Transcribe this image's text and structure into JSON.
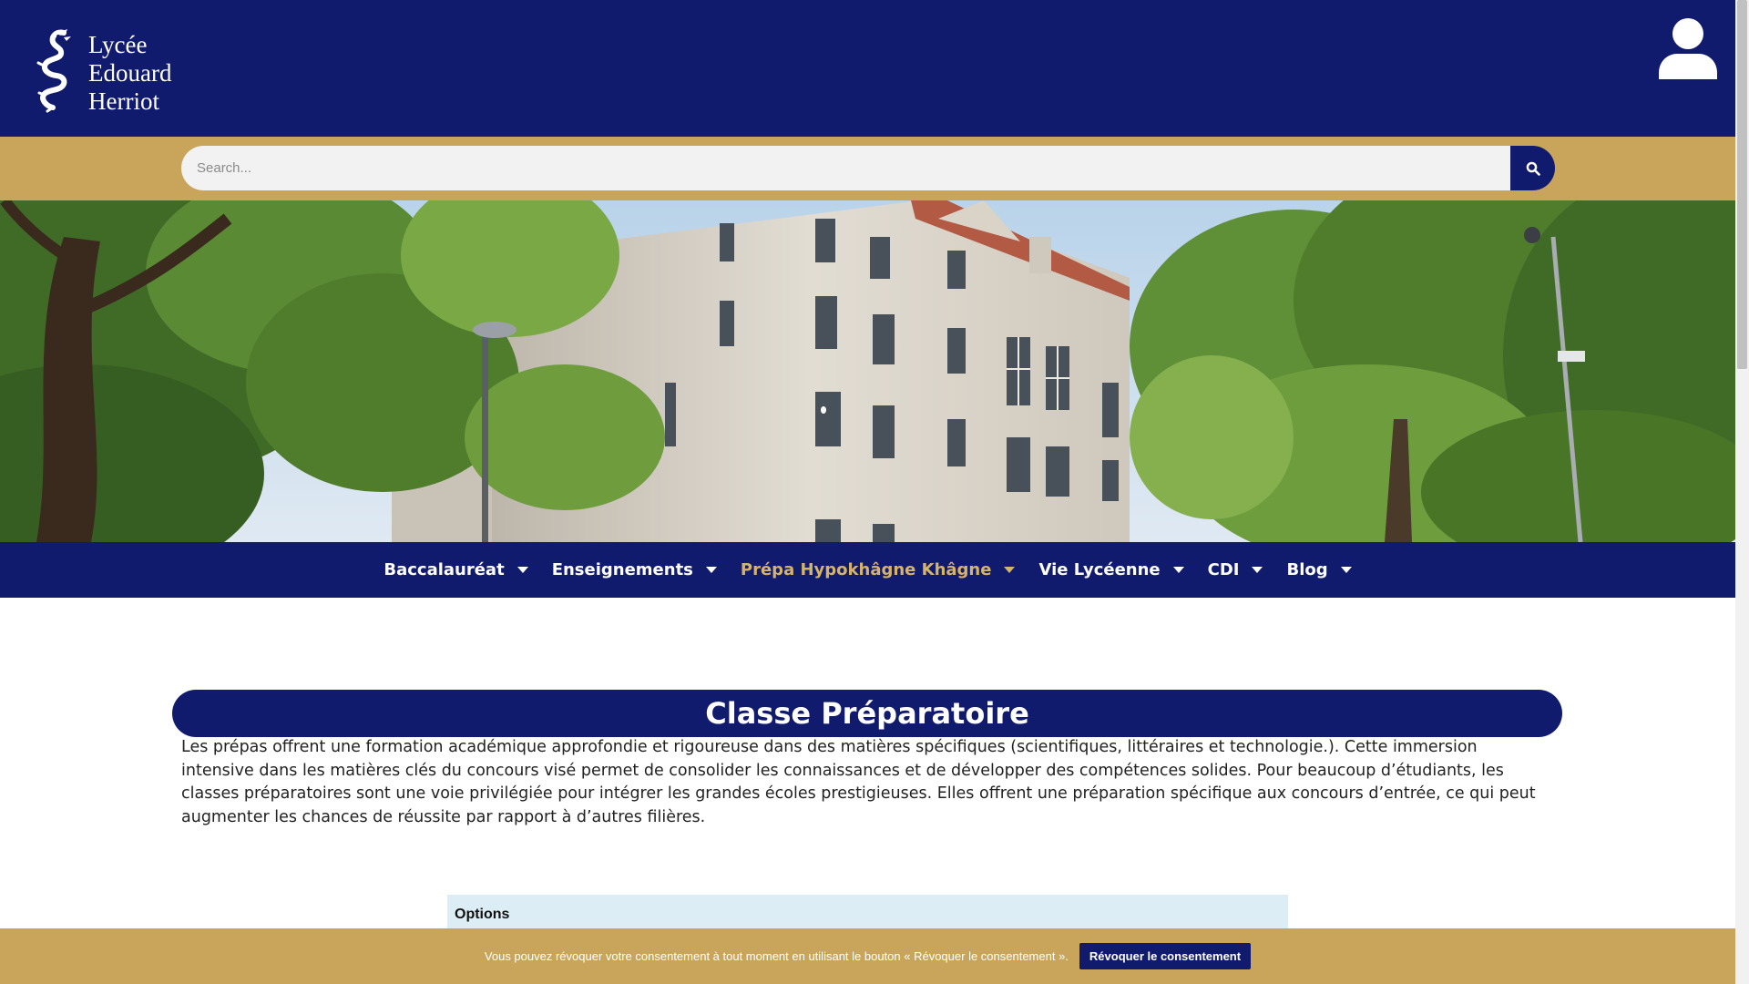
{
  "brand": {
    "lines": [
      "Lycée",
      "Edouard",
      "Herriot"
    ],
    "logo_icon": "dragon-emblem"
  },
  "header": {
    "user_icon": "user-icon"
  },
  "search": {
    "placeholder": "Search...",
    "icon": "search-icon"
  },
  "hero": {
    "image": "school-building-with-trees"
  },
  "nav": {
    "items": [
      {
        "label": "Baccalauréat",
        "active": false
      },
      {
        "label": "Enseignements",
        "active": false
      },
      {
        "label": "Prépa Hypokhâgne Khâgne",
        "active": true
      },
      {
        "label": "Vie Lycéenne",
        "active": false
      },
      {
        "label": "CDI",
        "active": false
      },
      {
        "label": "Blog",
        "active": false
      }
    ]
  },
  "content": {
    "title": "Classe Préparatoire",
    "intro": "Les prépas offrent une formation académique approfondie et rigoureuse dans des matières spécifiques (scientifiques, littéraires et technologie.). Cette immersion intensive dans les matières clés du concours visé permet de consolider les connaissances et de développer des compétences solides. Pour beaucoup d’étudiants, les classes préparatoires sont une voie privilégiée pour intégrer les grandes écoles prestigieuses. Elles offrent une préparation spécifique aux concours d’entrée, ce qui peut augmenter les chances de réussite par rapport à d’autres filières.",
    "options_label": "Options"
  },
  "cookie": {
    "text": "Vous pouvez révoquer votre consentement à tout moment en utilisant le bouton « Révoquer le consentement ».",
    "button": "Révoquer le consentement"
  },
  "colors": {
    "navy": "#111b6e",
    "gold": "#c9a55b",
    "active_nav": "#d6b36a",
    "options_bg": "#dcedf5"
  }
}
